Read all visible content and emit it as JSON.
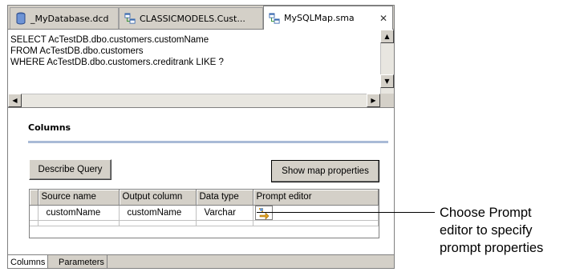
{
  "tabs": [
    {
      "label": "_MyDatabase.dcd",
      "icon": "database-icon",
      "active": false
    },
    {
      "label": "CLASSICMODELS.Cust...",
      "icon": "map-icon",
      "active": false
    },
    {
      "label": "MySQLMap.sma",
      "icon": "map-icon",
      "active": true,
      "close": "✕"
    }
  ],
  "sql": {
    "lines": [
      "SELECT AcTestDB.dbo.customers.customName",
      "FROM AcTestDB.dbo.customers",
      "WHERE AcTestDB.dbo.customers.creditrank LIKE ?"
    ]
  },
  "columns_section": {
    "title": "Columns",
    "describe_button": "Describe Query",
    "show_map_button": "Show map properties",
    "grid": {
      "headers": [
        "Source name",
        "Output column",
        "Data type",
        "Prompt editor"
      ],
      "rows": [
        [
          "customName",
          "customName",
          "Varchar",
          ""
        ]
      ]
    }
  },
  "bottom_tabs": [
    "Columns",
    "Parameters"
  ],
  "callout": {
    "lines": [
      "Choose Prompt",
      "editor to specify",
      "prompt properties"
    ]
  },
  "colors": {
    "chrome": "#d4d0c8",
    "section_line": "#a9bad6",
    "prompt_icon": "#e0a020"
  }
}
